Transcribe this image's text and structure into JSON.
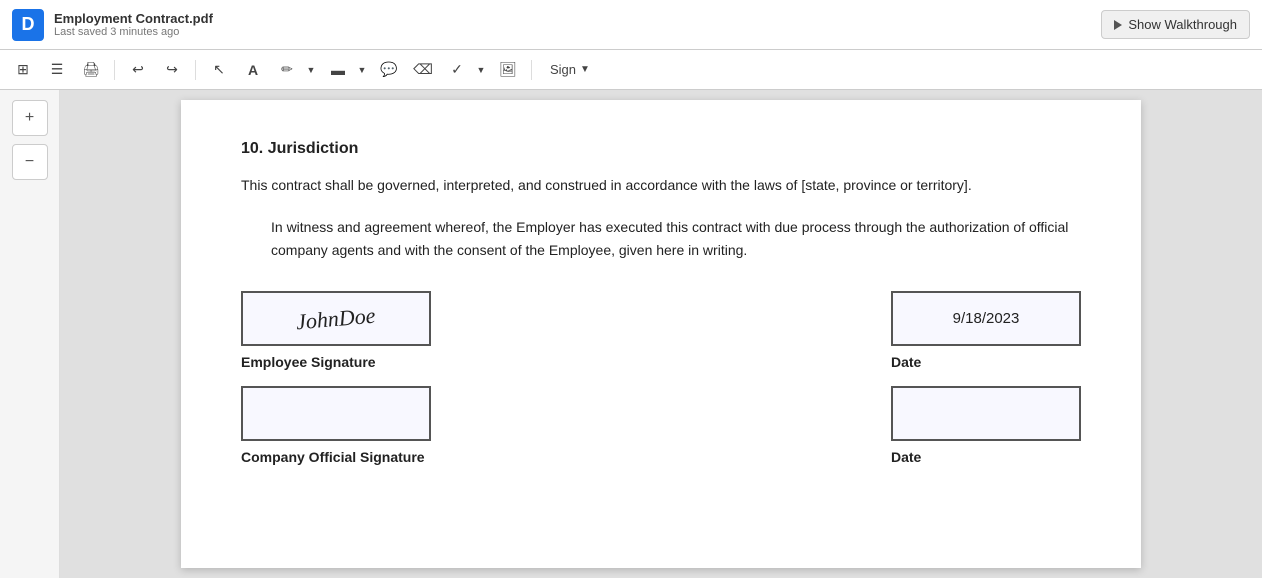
{
  "topbar": {
    "logo_letter": "D",
    "doc_title": "Employment Contract.pdf",
    "doc_saved": "Last saved 3 minutes ago",
    "walkthrough_btn": "Show Walkthrough"
  },
  "toolbar": {
    "undo_label": "↩",
    "redo_label": "↪",
    "text_label": "A",
    "pen_label": "✏",
    "highlight_label": "☑",
    "comment_label": "💬",
    "eraser_label": "⌫",
    "checkmark_label": "✓",
    "image_label": "🖼",
    "sign_label": "Sign"
  },
  "sidebar": {
    "zoom_in_label": "+",
    "zoom_out_label": "−"
  },
  "pdf": {
    "section_heading": "10. Jurisdiction",
    "paragraph1": "This contract shall be governed, interpreted, and construed in accordance with the laws of [state, province or territory].",
    "paragraph2": "In witness and agreement whereof, the Employer has executed this contract with due process through the authorization of official company agents and with the consent of the Employee, given here in writing.",
    "employee_sig_label": "Employee Signature",
    "company_sig_label": "Company Official Signature",
    "date_label1": "Date",
    "date_label2": "Date",
    "date_value": "9/18/2023"
  }
}
